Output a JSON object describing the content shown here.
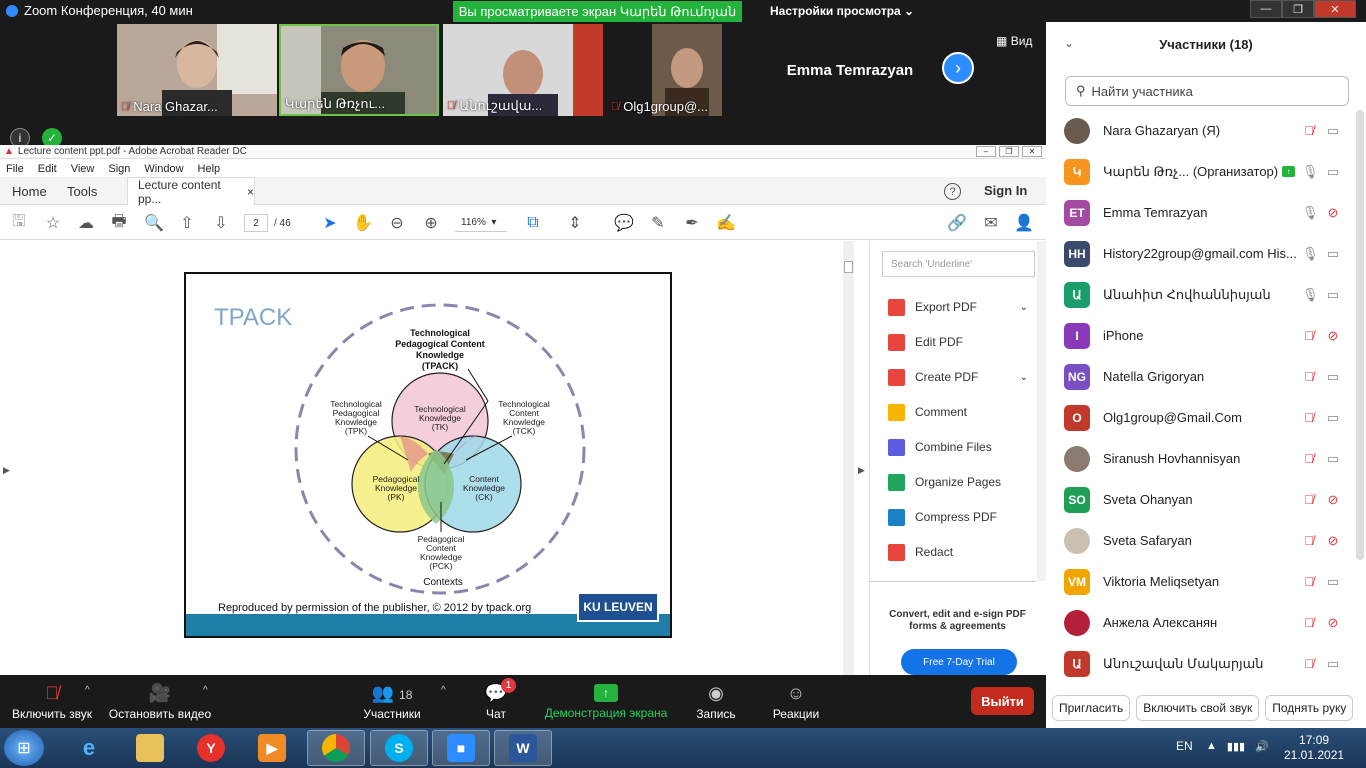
{
  "zoom": {
    "window_title": "Zoom Конференция, 40 мин",
    "viewing_banner": "Вы  просматриваете  экран Կարեն Թումոյան",
    "view_settings": "Настройки просмотра",
    "view_button": "Вид",
    "tiles": [
      {
        "name": "Nara Ghazar...",
        "muted": true
      },
      {
        "name": "Կարեն Թռչու...",
        "muted": false,
        "active": true
      },
      {
        "name": "Անուշավա...",
        "muted": true
      },
      {
        "name": "Olg1group@...",
        "muted": true
      }
    ],
    "emma_tile": "Emma Temrazyan",
    "bottom_bar": {
      "unmute": "Включить звук",
      "start_video": "Остановить видео",
      "participants": "Участники",
      "participants_count": "18",
      "chat": "Чат",
      "chat_badge": "1",
      "share": "Демонстрация экрана",
      "record": "Запись",
      "reactions": "Реакции",
      "leave": "Выйти"
    }
  },
  "acrobat": {
    "window_title": "Lecture content ppt.pdf - Adobe Acrobat Reader DC",
    "menu": [
      "File",
      "Edit",
      "View",
      "Sign",
      "Window",
      "Help"
    ],
    "tabs": {
      "home": "Home",
      "tools": "Tools",
      "doc": "Lecture content pp...",
      "close": "×"
    },
    "help": "?",
    "sign_in": "Sign In",
    "page_current": "2",
    "page_total": "/ 46",
    "zoom": "116%",
    "search_placeholder": "Search 'Underline'",
    "tools": [
      {
        "label": "Export PDF",
        "color": "#e8453c",
        "chevron": true
      },
      {
        "label": "Edit PDF",
        "color": "#e8453c"
      },
      {
        "label": "Create PDF",
        "color": "#e8453c",
        "chevron": true
      },
      {
        "label": "Comment",
        "color": "#f7b500"
      },
      {
        "label": "Combine Files",
        "color": "#5c5ce0"
      },
      {
        "label": "Organize Pages",
        "color": "#22a45d"
      },
      {
        "label": "Compress PDF",
        "color": "#1a82c4"
      },
      {
        "label": "Redact",
        "color": "#e8453c"
      }
    ],
    "convert_text": "Convert, edit and e-sign PDF forms & agreements",
    "trial_button": "Free 7-Day Trial",
    "slide": {
      "title": "TPACK",
      "tpack_label": [
        "Technological",
        "Pedagogical Content",
        "Knowledge",
        "(TPACK)"
      ],
      "tpk_label": [
        "Technological",
        "Pedagogical",
        "Knowledge",
        "(TPK)"
      ],
      "tck_label": [
        "Technological",
        "Content",
        "Knowledge",
        "(TCK)"
      ],
      "tk_label": [
        "Technological",
        "Knowledge",
        "(TK)"
      ],
      "pk_label": [
        "Pedagogical",
        "Knowledge",
        "(PK)"
      ],
      "ck_label": [
        "Content",
        "Knowledge",
        "(CK)"
      ],
      "pck_label": [
        "Pedagogical",
        "Content",
        "Knowledge",
        "(PCK)"
      ],
      "contexts": "Contexts",
      "footer": "Reproduced by permission of the publisher, © 2012 by tpack.org",
      "logo": "KU LEUVEN"
    }
  },
  "participants": {
    "header": "Участники (18)",
    "search_placeholder": "Найти участника",
    "list": [
      {
        "name": "Nara Ghazaryan (Я)",
        "initials": "",
        "color": "#6b5a4e",
        "mic": "muted",
        "cam": "on",
        "photo": true
      },
      {
        "name": "Կարեն Թռչ...  (Организатор)",
        "initials": "Կ",
        "color": "#f7941d",
        "mic": "on",
        "cam": "on",
        "host": true
      },
      {
        "name": "Emma Temrazyan",
        "initials": "ET",
        "color": "#a34aa3",
        "mic": "on",
        "cam": "off"
      },
      {
        "name": "History22group@gmail.com His...",
        "initials": "HH",
        "color": "#3a4a6b",
        "mic": "on",
        "cam": "on"
      },
      {
        "name": "Անահիտ Հովհաննիսյան",
        "initials": "Ա",
        "color": "#1a9e6a",
        "mic": "on",
        "cam": "on"
      },
      {
        "name": "iPhone",
        "initials": "I",
        "color": "#8a3ab9",
        "mic": "muted",
        "cam": "off"
      },
      {
        "name": "Natella Grigoryan",
        "initials": "NG",
        "color": "#7b4fc4",
        "mic": "muted",
        "cam": "on"
      },
      {
        "name": "Olg1group@Gmail.Com",
        "initials": "O",
        "color": "#c0392b",
        "mic": "muted",
        "cam": "on"
      },
      {
        "name": "Siranush Hovhannisyan",
        "initials": "",
        "color": "#8a7a70",
        "mic": "muted",
        "cam": "on",
        "photo": true
      },
      {
        "name": "Sveta Ohanyan",
        "initials": "SO",
        "color": "#1f9e55",
        "mic": "muted",
        "cam": "off"
      },
      {
        "name": "Sveta Safaryan",
        "initials": "",
        "color": "#c9c0b0",
        "mic": "muted",
        "cam": "off",
        "photo": true
      },
      {
        "name": "Viktoria Meliqsetyan",
        "initials": "VM",
        "color": "#f0a500",
        "mic": "muted",
        "cam": "on"
      },
      {
        "name": "Анжела Алексанян",
        "initials": "",
        "color": "#b3203a",
        "mic": "muted",
        "cam": "off",
        "photo": true
      },
      {
        "name": "Անուշավան Մակարյան",
        "initials": "Ա",
        "color": "#c0392b",
        "mic": "muted",
        "cam": "on"
      }
    ],
    "footer": {
      "invite": "Пригласить",
      "unmute_me": "Включить свой звук",
      "raise_hand": "Поднять руку"
    }
  },
  "taskbar": {
    "lang": "EN",
    "time": "17:09",
    "date": "21.01.2021"
  }
}
